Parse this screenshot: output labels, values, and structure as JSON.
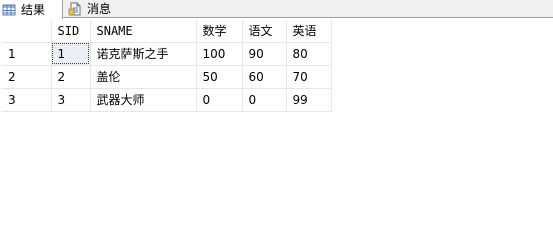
{
  "tabs": {
    "results_label": "结果",
    "messages_label": "消息"
  },
  "grid": {
    "columns": [
      "",
      "SID",
      "SNAME",
      "数学",
      "语文",
      "英语"
    ],
    "rows": [
      {
        "rownum": "1",
        "sid": "1",
        "sname": "诺克萨斯之手",
        "math": "100",
        "chinese": "90",
        "english": "80"
      },
      {
        "rownum": "2",
        "sid": "2",
        "sname": "盖伦",
        "math": "50",
        "chinese": "60",
        "english": "70"
      },
      {
        "rownum": "3",
        "sid": "3",
        "sname": "武器大师",
        "math": "0",
        "chinese": "0",
        "english": "99"
      }
    ]
  },
  "icons": {
    "results_tab_icon": "grid-icon",
    "messages_tab_icon": "document-icon"
  }
}
